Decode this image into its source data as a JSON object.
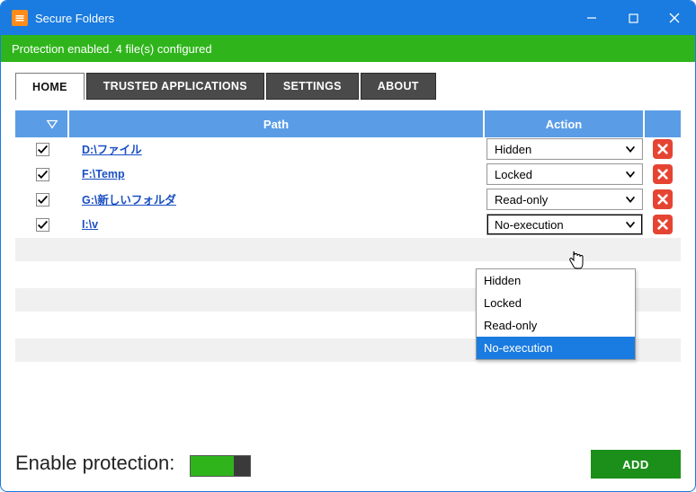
{
  "window": {
    "title": "Secure Folders"
  },
  "status": {
    "text": "Protection enabled. 4 file(s) configured"
  },
  "tabs": {
    "home": "HOME",
    "trusted": "TRUSTED APPLICATIONS",
    "settings": "SETTINGS",
    "about": "ABOUT",
    "active": "home"
  },
  "columns": {
    "path": "Path",
    "action": "Action"
  },
  "rows": [
    {
      "checked": true,
      "path": "D:\\ファイル",
      "action": "Hidden"
    },
    {
      "checked": true,
      "path": "F:\\Temp",
      "action": "Locked"
    },
    {
      "checked": true,
      "path": "G:\\新しいフォルダ",
      "action": "Read-only"
    },
    {
      "checked": true,
      "path": "I:\\v",
      "action": "No-execution",
      "dropdown_open": true
    }
  ],
  "action_options": [
    "Hidden",
    "Locked",
    "Read-only",
    "No-execution"
  ],
  "dropdown_highlight": "No-execution",
  "bottom": {
    "enable_label": "Enable protection:",
    "enabled": true,
    "add_label": "ADD"
  },
  "colors": {
    "accent": "#1a7be0",
    "success": "#2fb51b",
    "danger": "#e64433",
    "tab_inactive": "#4a4a4a",
    "header_blue": "#5a9de6"
  }
}
